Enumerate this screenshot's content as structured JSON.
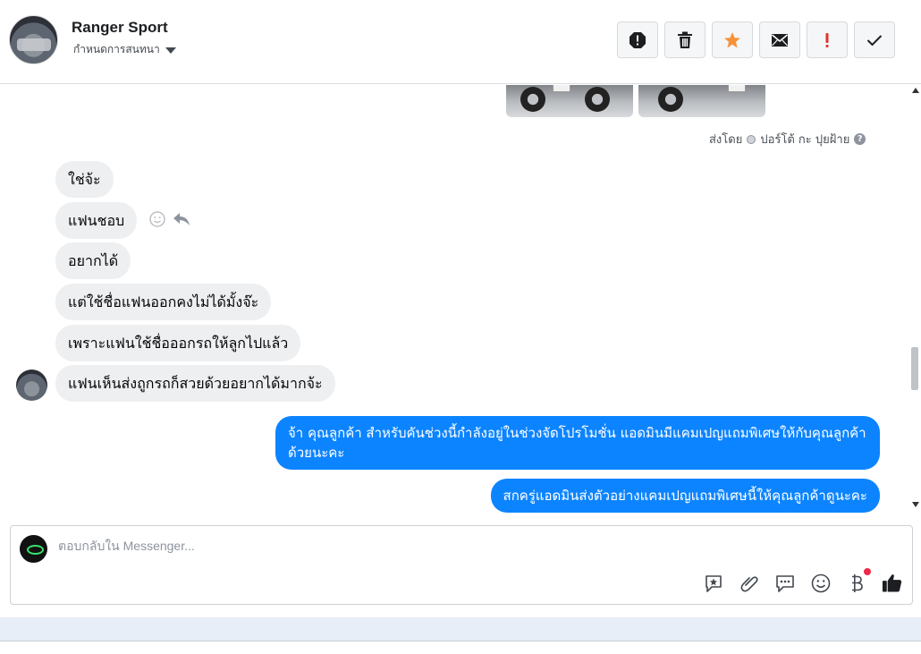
{
  "header": {
    "title": "Ranger Sport",
    "subtitle": "กำหนดการสนทนา",
    "actions": [
      {
        "name": "report-spam-button",
        "icon": "alert-octagon-icon"
      },
      {
        "name": "delete-button",
        "icon": "trash-icon"
      },
      {
        "name": "star-button",
        "icon": "star-icon",
        "color": "#f7923b"
      },
      {
        "name": "mark-unread-button",
        "icon": "envelope-icon"
      },
      {
        "name": "important-button",
        "icon": "exclamation-icon",
        "color": "#e4312c"
      },
      {
        "name": "mark-done-button",
        "icon": "check-icon"
      }
    ]
  },
  "conversation": {
    "sent_by": {
      "prefix": "ส่งโดย",
      "name": "ปอร์โต้ กะ ปุยฝ้าย"
    },
    "incoming": [
      "ใช่จ้ะ",
      "แฟนชอบ",
      "อยากได้",
      "แต่ใช้ชื่อแฟนออกคงไม่ได้มั้งจ๊ะ",
      "เพราะแฟนใช้ชื่อออกรถให้ลูกไปแล้ว",
      "แฟนเห็นส่งถูกรถก็สวยด้วยอยากได้มากจ้ะ"
    ],
    "outgoing": [
      "จ้า คุณลูกค้า สำหรับคันช่วงนี้กำลังอยู่ในช่วงจัดโปรโมชั่น  แอดมินมีแคมเปญแถมพิเศษให้กับคุณลูกค้าด้วยนะคะ",
      "สกครู่แอดมินส่งตัวอย่างแคมเปญแถมพิเศษนี้ให้คุณลูกค้าดูนะคะ"
    ]
  },
  "composer": {
    "placeholder": "ตอบกลับใน Messenger...",
    "tools": [
      "saved-reply-icon",
      "attach-icon",
      "message-bubble-icon",
      "emoji-icon",
      "baht-payment-icon",
      "thumbs-up-icon"
    ]
  },
  "colors": {
    "outgoing_bubble": "#0c84ff",
    "incoming_bubble": "#eeeff1",
    "star": "#f7923b",
    "important": "#e4312c"
  }
}
